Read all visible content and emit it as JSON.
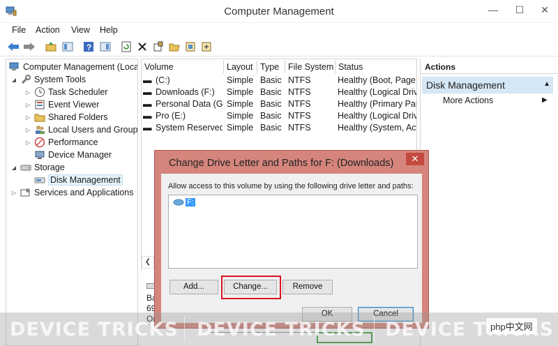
{
  "window": {
    "title": "Computer Management"
  },
  "menu": [
    "File",
    "Action",
    "View",
    "Help"
  ],
  "tree": {
    "root": "Computer Management (Local",
    "system_tools": "System Tools",
    "task_scheduler": "Task Scheduler",
    "event_viewer": "Event Viewer",
    "shared_folders": "Shared Folders",
    "local_users": "Local Users and Groups",
    "performance": "Performance",
    "device_manager": "Device Manager",
    "storage": "Storage",
    "disk_management": "Disk Management",
    "services": "Services and Applications"
  },
  "volumes": {
    "headers": [
      "Volume",
      "Layout",
      "Type",
      "File System",
      "Status"
    ],
    "rows": [
      [
        "(C:)",
        "Simple",
        "Basic",
        "NTFS",
        "Healthy (Boot, Page F"
      ],
      [
        "Downloads (F:)",
        "Simple",
        "Basic",
        "NTFS",
        "Healthy (Logical Drive"
      ],
      [
        "Personal Data (G:)",
        "Simple",
        "Basic",
        "NTFS",
        "Healthy (Primary Part"
      ],
      [
        "Pro (E:)",
        "Simple",
        "Basic",
        "NTFS",
        "Healthy (Logical Drive"
      ],
      [
        "System Reserved",
        "Simple",
        "Basic",
        "NTFS",
        "Healthy (System, Acti"
      ]
    ],
    "partial": [
      "Ba",
      "69",
      "On"
    ]
  },
  "actions": {
    "header": "Actions",
    "section": "Disk Management",
    "more": "More Actions"
  },
  "dialog": {
    "title": "Change Drive Letter and Paths for F: (Downloads)",
    "close": "✕",
    "label": "Allow access to this volume by using the following drive letter and paths:",
    "item": "F:",
    "add": "Add...",
    "change": "Change...",
    "remove": "Remove",
    "ok": "OK",
    "cancel": "Cancel"
  },
  "watermark": {
    "text1": "DEVICE TRICKS",
    "text2": "DEVICE TRICKS",
    "text3": "DEVICE TRICKS",
    "site": "php中文网"
  },
  "colors": {
    "dialog_frame": "#d5857c",
    "selection": "#3399ff",
    "highlight": "#d9141e",
    "action_section": "#d5e6f4"
  }
}
